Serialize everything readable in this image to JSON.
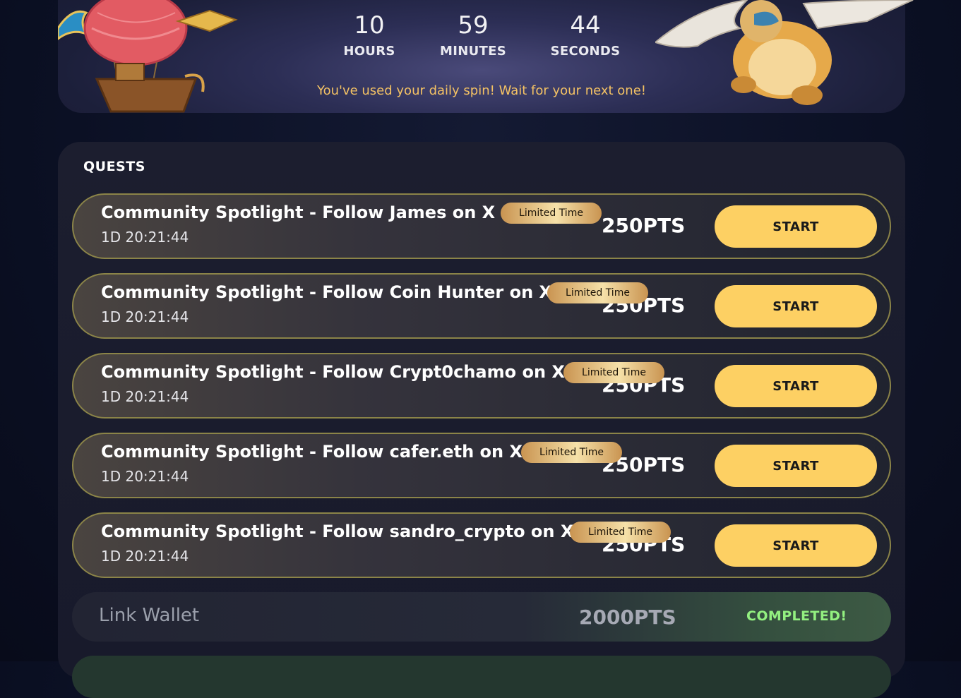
{
  "countdown": {
    "hours_value": "10",
    "hours_label": "HOURS",
    "minutes_value": "59",
    "minutes_label": "MINUTES",
    "seconds_value": "44",
    "seconds_label": "SECONDS",
    "message": "You've used your daily spin! Wait for your next one!"
  },
  "quests": {
    "title": "QUESTS",
    "items": [
      {
        "title": "Community Spotlight - Follow James on X",
        "badge": "Limited Time",
        "time": "1D 20:21:44",
        "points": "250PTS",
        "button": "START"
      },
      {
        "title": "Community Spotlight - Follow Coin Hunter on X",
        "badge": "Limited Time",
        "time": "1D 20:21:44",
        "points": "250PTS",
        "button": "START"
      },
      {
        "title": "Community Spotlight - Follow Crypt0chamo on X",
        "badge": "Limited Time",
        "time": "1D 20:21:44",
        "points": "250PTS",
        "button": "START"
      },
      {
        "title": "Community Spotlight - Follow cafer.eth on X",
        "badge": "Limited Time",
        "time": "1D 20:21:44",
        "points": "250PTS",
        "button": "START"
      },
      {
        "title": "Community Spotlight - Follow sandro_crypto on X",
        "badge": "Limited Time",
        "time": "1D 20:21:44",
        "points": "250PTS",
        "button": "START"
      }
    ],
    "completed": {
      "label": "Link Wallet",
      "points": "2000PTS",
      "status": "COMPLETED!"
    }
  },
  "colors": {
    "accent_button": "#fdd063",
    "message_text": "#f4c264",
    "completed_text": "#93f080",
    "quest_border": "#8b8448"
  },
  "icons": {
    "banner_left": "airship-illustration",
    "banner_right": "griffin-illustration"
  }
}
